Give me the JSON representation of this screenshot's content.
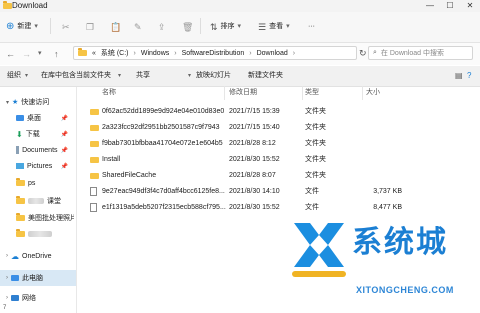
{
  "window": {
    "title": "Download",
    "controls": [
      "—",
      "☐",
      "✕"
    ]
  },
  "toolbar": {
    "new_label": "新建",
    "sort_label": "排序",
    "view_label": "查看",
    "more_label": "···"
  },
  "address": {
    "crumbs": [
      "«",
      "系统 (C:)",
      "Windows",
      "SoftwareDistribution",
      "Download"
    ],
    "refresh": "↻"
  },
  "search": {
    "placeholder": "在 Download 中搜索"
  },
  "commands": [
    "组织",
    "在库中包含当前文件夹",
    "共享",
    "放映幻灯片",
    "新建文件夹"
  ],
  "sidebar": {
    "quick_access": "快速访问",
    "items": [
      {
        "label": "桌面",
        "icon": "desktop-icon"
      },
      {
        "label": "下载",
        "icon": "download-icon"
      },
      {
        "label": "Documents",
        "icon": "documents-icon"
      },
      {
        "label": "Pictures",
        "icon": "pictures-icon"
      },
      {
        "label": "ps",
        "icon": "folder-icon"
      },
      {
        "label": "课堂",
        "icon": "folder-icon"
      },
      {
        "label": "美图批处理照片",
        "icon": "folder-icon"
      },
      {
        "label": "",
        "icon": "folder-icon"
      }
    ],
    "onedrive": "OneDrive",
    "this_pc": "此电脑",
    "network": "网络"
  },
  "columns": {
    "name": "名称",
    "modified": "修改日期",
    "type": "类型",
    "size": "大小"
  },
  "files": [
    {
      "name": "0f62ac52dd1899e9d924e04e010d83e0",
      "modified": "2021/7/15 15:39",
      "type": "文件夹",
      "size": "",
      "kind": "folder"
    },
    {
      "name": "2a323fcc92df2951bb2501587c9f7943",
      "modified": "2021/7/15 15:40",
      "type": "文件夹",
      "size": "",
      "kind": "folder"
    },
    {
      "name": "f9bab7301bfbbaa41704e072e1e604b5",
      "modified": "2021/8/28 8:12",
      "type": "文件夹",
      "size": "",
      "kind": "folder"
    },
    {
      "name": "Install",
      "modified": "2021/8/30 15:52",
      "type": "文件夹",
      "size": "",
      "kind": "folder"
    },
    {
      "name": "SharedFileCache",
      "modified": "2021/8/28 8:07",
      "type": "文件夹",
      "size": "",
      "kind": "folder"
    },
    {
      "name": "9e27eac949df3f4c7d0aff4bcc6125fe8...",
      "modified": "2021/8/30 14:10",
      "type": "文件",
      "size": "3,737 KB",
      "kind": "file"
    },
    {
      "name": "e1f1319a5deb5207f2315ecb588cf795...",
      "modified": "2021/8/30 15:52",
      "type": "文件",
      "size": "8,477 KB",
      "kind": "file"
    }
  ],
  "watermark": {
    "text": "系统城",
    "url": "XITONGCHENG.COM"
  },
  "colors": {
    "accent": "#1b7fd3",
    "folder": "#f6c445"
  }
}
